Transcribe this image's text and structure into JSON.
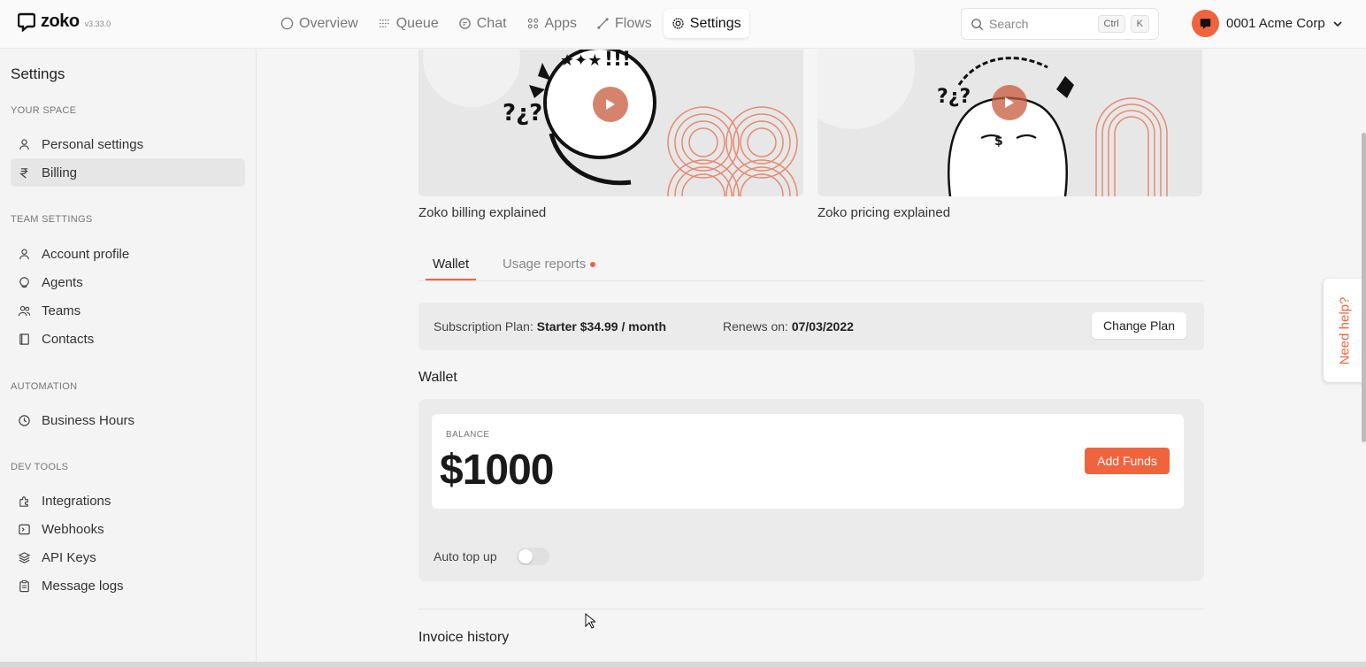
{
  "app": {
    "name": "zoko",
    "version": "v3.33.0"
  },
  "nav": {
    "items": [
      {
        "label": "Overview",
        "icon": "circle-icon"
      },
      {
        "label": "Queue",
        "icon": "list-icon"
      },
      {
        "label": "Chat",
        "icon": "chat-icon"
      },
      {
        "label": "Apps",
        "icon": "grid-icon"
      },
      {
        "label": "Flows",
        "icon": "flow-icon"
      },
      {
        "label": "Settings",
        "icon": "gear-icon",
        "active": true
      }
    ]
  },
  "search": {
    "placeholder": "Search",
    "shortcut_mod": "Ctrl",
    "shortcut_key": "K"
  },
  "account": {
    "name": "0001 Acme Corp"
  },
  "sidebar": {
    "title": "Settings",
    "sections": [
      {
        "label": "YOUR SPACE",
        "items": [
          {
            "label": "Personal settings",
            "icon": "user-icon"
          },
          {
            "label": "Billing",
            "icon": "rupee-icon",
            "active": true
          }
        ]
      },
      {
        "label": "TEAM SETTINGS",
        "items": [
          {
            "label": "Account profile",
            "icon": "user-icon"
          },
          {
            "label": "Agents",
            "icon": "headset-icon"
          },
          {
            "label": "Teams",
            "icon": "users-icon"
          },
          {
            "label": "Contacts",
            "icon": "book-icon"
          }
        ]
      },
      {
        "label": "AUTOMATION",
        "items": [
          {
            "label": "Business Hours",
            "icon": "clock-icon"
          }
        ]
      },
      {
        "label": "DEV TOOLS",
        "items": [
          {
            "label": "Integrations",
            "icon": "puzzle-icon"
          },
          {
            "label": "Webhooks",
            "icon": "terminal-icon"
          },
          {
            "label": "API Keys",
            "icon": "layers-icon"
          },
          {
            "label": "Message logs",
            "icon": "clipboard-icon"
          }
        ]
      }
    ]
  },
  "videos": [
    {
      "caption": "Zoko billing explained"
    },
    {
      "caption": "Zoko pricing explained"
    }
  ],
  "tabs": [
    {
      "label": "Wallet",
      "active": true
    },
    {
      "label": "Usage reports",
      "has_dot": true
    }
  ],
  "plan": {
    "label": "Subscription Plan:",
    "value": "Starter $34.99 / month",
    "renews_label": "Renews on:",
    "renews_value": "07/03/2022",
    "button": "Change Plan"
  },
  "wallet": {
    "title": "Wallet",
    "balance_label": "BALANCE",
    "balance": "$1000",
    "add_funds": "Add Funds",
    "auto_topup_label": "Auto top up",
    "auto_topup_enabled": false
  },
  "invoice": {
    "title": "Invoice history"
  },
  "help": {
    "label": "Need help?"
  },
  "colors": {
    "accent": "#f0643d",
    "background": "#f5f5f5"
  }
}
